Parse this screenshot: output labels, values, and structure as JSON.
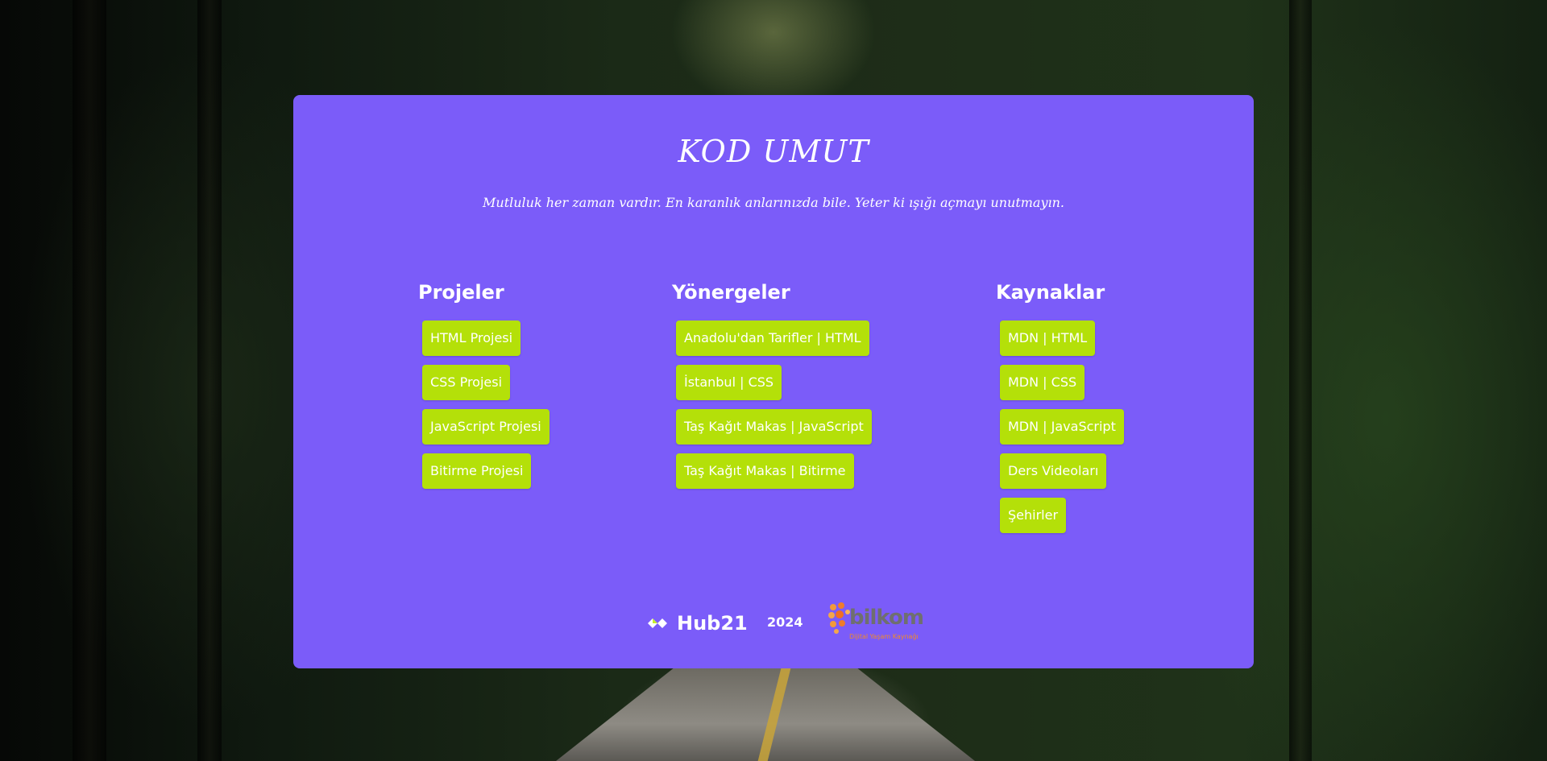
{
  "header": {
    "title": "KOD UMUT",
    "subtitle": "Mutluluk her zaman vardır. En karanlık anlarınızda bile. Yeter ki ışığı açmayı unutmayın."
  },
  "columns": [
    {
      "heading": "Projeler",
      "links": [
        "HTML Projesi",
        "CSS Projesi",
        "JavaScript Projesi",
        "Bitirme Projesi"
      ]
    },
    {
      "heading": "Yönergeler",
      "links": [
        "Anadolu'dan Tarifler | HTML",
        "İstanbul | CSS",
        "Taş Kağıt Makas | JavaScript",
        "Taş Kağıt Makas | Bitirme"
      ]
    },
    {
      "heading": "Kaynaklar",
      "links": [
        "MDN | HTML",
        "MDN | CSS",
        "MDN | JavaScript",
        "Ders Videoları",
        "Şehirler"
      ]
    }
  ],
  "footer": {
    "hub_logo_text": "Hub21",
    "year": "2024",
    "bilkom_logo_text": "bilkom",
    "bilkom_tagline": "Dijital Yaşam Kaynağı"
  },
  "colors": {
    "card": "#7b5cf9",
    "button": "#b4e009",
    "text": "#ffffff"
  }
}
